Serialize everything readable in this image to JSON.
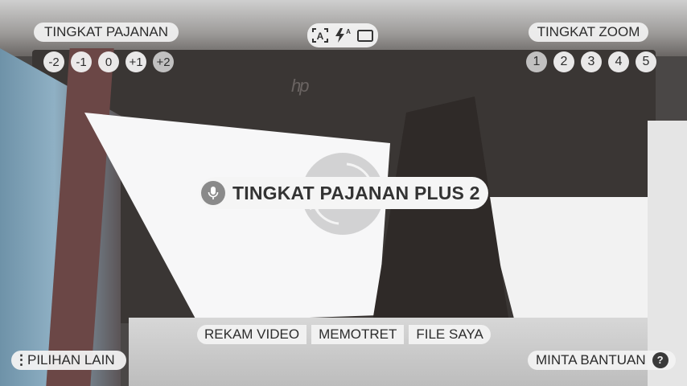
{
  "exposure": {
    "label": "TINGKAT PAJANAN",
    "levels": [
      "-2",
      "-1",
      "0",
      "+1",
      "+2"
    ],
    "selected": "+2"
  },
  "zoom": {
    "label": "TINGKAT ZOOM",
    "levels": [
      "1",
      "2",
      "3",
      "4",
      "5"
    ],
    "selected": "1"
  },
  "toolbar": {
    "icons": [
      "auto-focus-icon",
      "flash-auto-icon",
      "aspect-ratio-icon"
    ]
  },
  "scene": {
    "brand_mark": "hp"
  },
  "shutter": {
    "icon": "camera-switch-icon"
  },
  "toast": {
    "icon": "mic-icon",
    "text": "TINGKAT PAJANAN PLUS 2"
  },
  "modes": {
    "video": "REKAM VIDEO",
    "photo": "MEMOTRET",
    "files": "FILE SAYA"
  },
  "more_options": {
    "icon": "more-vert-icon",
    "label": "PILIHAN LAIN"
  },
  "help": {
    "label": "MINTA BANTUAN",
    "icon_glyph": "?"
  }
}
